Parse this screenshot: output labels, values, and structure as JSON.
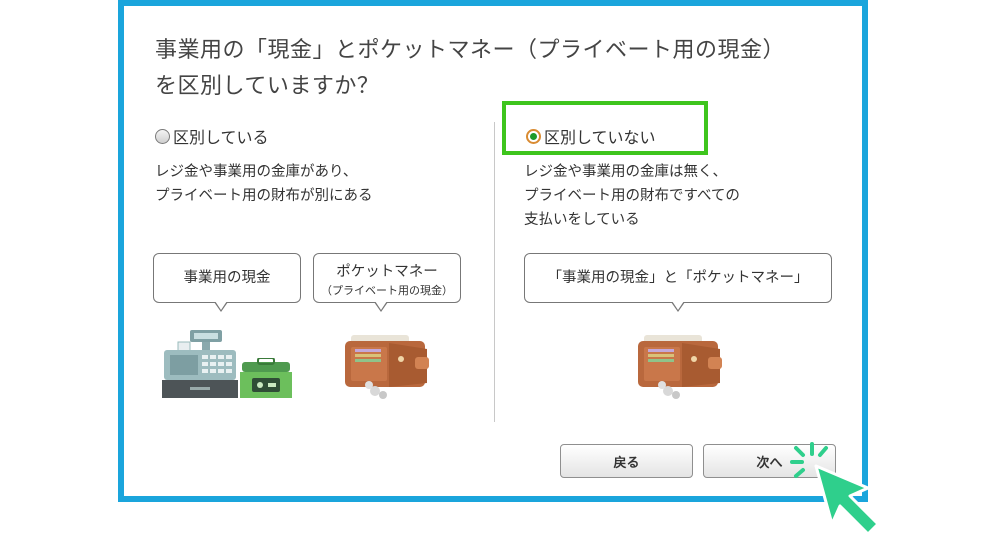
{
  "dialog": {
    "title_line1": "事業用の「現金」とポケットマネー（プライベート用の現金）",
    "title_line2": "を区別していますか？"
  },
  "options": [
    {
      "label": "区別している",
      "checked": false,
      "desc_line1": "レジ金や事業用の金庫があり、",
      "desc_line2": "プライベート用の財布が別にある",
      "desc_line3": ""
    },
    {
      "label": "区別していない",
      "checked": true,
      "desc_line1": "レジ金や事業用の金庫は無く、",
      "desc_line2": "プライベート用の財布ですべての",
      "desc_line3": "支払いをしている"
    }
  ],
  "bubbles": {
    "business_cash": "事業用の現金",
    "pocket_money": "ポケットマネー",
    "pocket_money_sub": "（プライベート用の現金）",
    "combined": "「事業用の現金」と「ポケットマネー」"
  },
  "buttons": {
    "back": "戻る",
    "next": "次へ"
  },
  "colors": {
    "frame": "#1aa5dc",
    "highlight": "#3ec51d",
    "radio_dot": "#1d9a2a",
    "cursor": "#2fcf8c"
  },
  "icons": [
    "cash-register-icon",
    "cash-box-icon",
    "wallet-icon",
    "cursor-pointer-icon"
  ]
}
